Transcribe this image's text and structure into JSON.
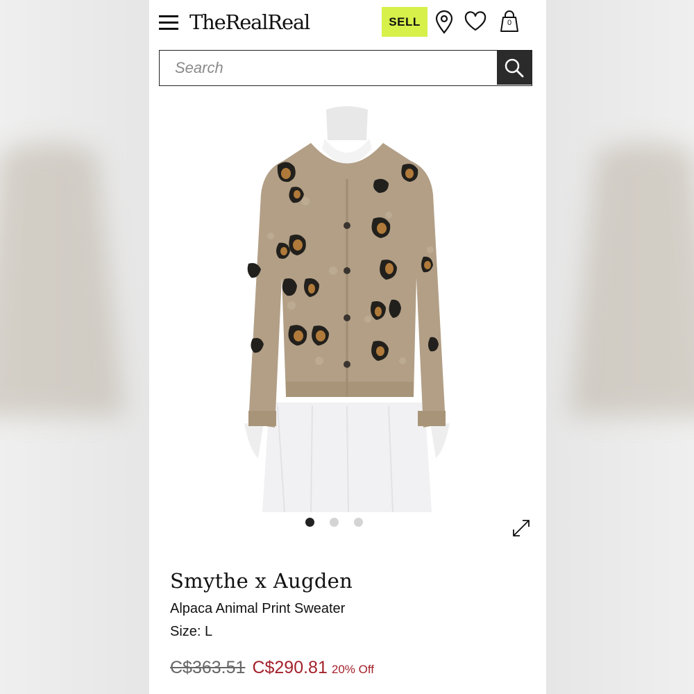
{
  "header": {
    "logo": "TheRealReal",
    "sell_label": "SELL",
    "bag_count": "0"
  },
  "search": {
    "placeholder": "Search"
  },
  "carousel": {
    "total": 3,
    "active_index": 0
  },
  "product": {
    "designer": "Smythe x Augden",
    "title": "Alpaca Animal Print Sweater",
    "size": "Size: L",
    "original_price": "C$363.51",
    "sale_price": "C$290.81",
    "discount": "20% Off"
  },
  "icons": [
    "menu-icon",
    "location-pin-icon",
    "heart-icon",
    "shopping-bag-icon",
    "search-icon",
    "expand-icon"
  ],
  "colors": {
    "sell_button": "#d7f04a",
    "sale_price": "#a3212b",
    "search_button": "#2b2b2b"
  }
}
